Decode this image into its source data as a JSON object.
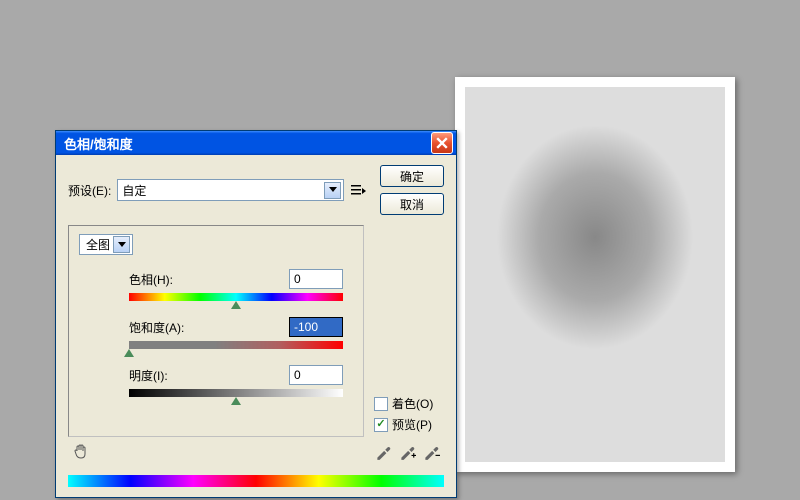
{
  "dialog": {
    "title": "色相/饱和度",
    "preset_label": "预设(E):",
    "preset_value": "自定",
    "ok": "确定",
    "cancel": "取消",
    "range_value": "全图",
    "hue": {
      "label": "色相(H):",
      "value": "0",
      "thumb_pct": 50
    },
    "saturation": {
      "label": "饱和度(A):",
      "value": "-100",
      "thumb_pct": 0
    },
    "lightness": {
      "label": "明度(I):",
      "value": "0",
      "thumb_pct": 50
    },
    "colorize_label": "着色(O)",
    "preview_label": "预览(P)",
    "colorize_checked": false,
    "preview_checked": true
  }
}
